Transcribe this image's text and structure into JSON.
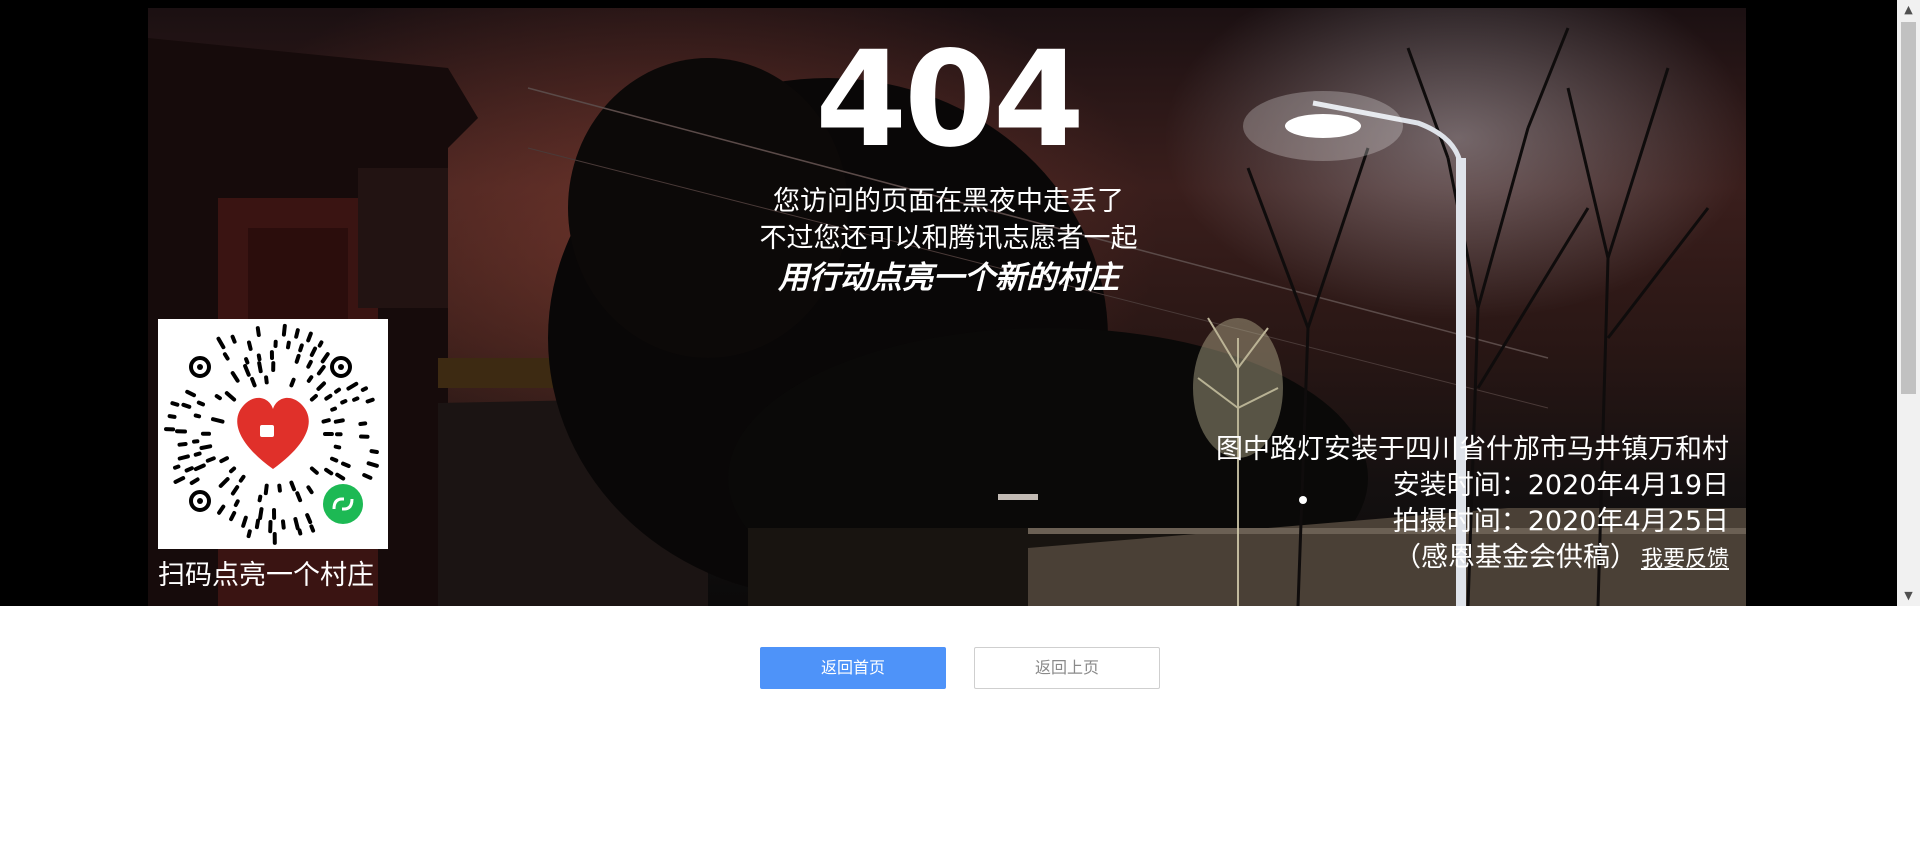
{
  "error": {
    "code": "404",
    "line1": "您访问的页面在黑夜中走丢了",
    "line2": "不过您还可以和腾讯志愿者一起",
    "line3": "用行动点亮一个新的村庄"
  },
  "qr": {
    "caption": "扫码点亮一个村庄",
    "heart_color": "#e0302a",
    "badge_color": "#1db954"
  },
  "credits": {
    "location": "图中路灯安装于四川省什邡市马井镇万和村",
    "install_time": "安装时间：2020年4月19日",
    "photo_time": "拍摄时间：2020年4月25日",
    "source": "（感恩基金会供稿）",
    "feedback_link": "我要反馈"
  },
  "buttons": {
    "home": "返回首页",
    "back": "返回上页"
  },
  "colors": {
    "primary": "#4e93f9"
  }
}
